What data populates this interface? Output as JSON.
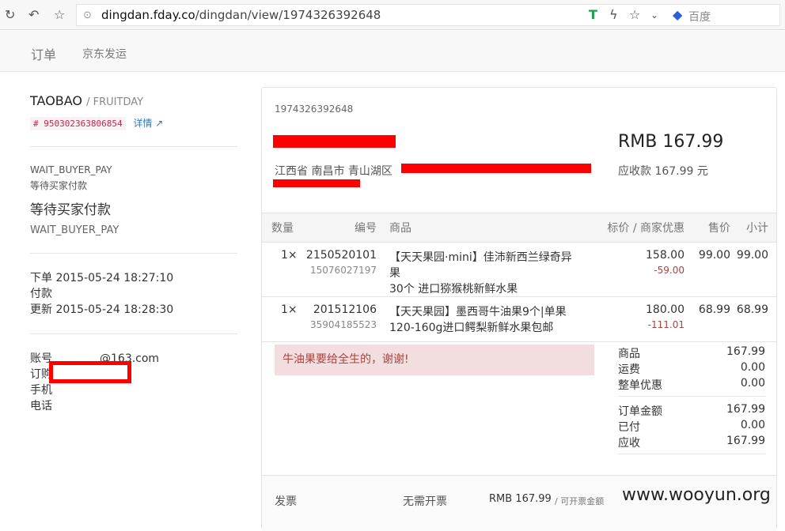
{
  "browser": {
    "url_domain": "dingdan.fday.co",
    "url_path": "/dingdan/view/1974326392648",
    "search_engine": "百度"
  },
  "nav": {
    "items": [
      "订单",
      "京东发运"
    ]
  },
  "order_meta": {
    "source": "TAOBAO",
    "sep_brand": "/ FRUITDAY",
    "trade_id": "# 950302363806854",
    "detail_link": "详情",
    "status_code": "WAIT_BUYER_PAY",
    "status_cn_small": "等待买家付款",
    "status_cn_large": "等待买家付款",
    "status_code2": "WAIT_BUYER_PAY",
    "time_rows": [
      {
        "label": "下单",
        "value": "2015-05-24 18:27:10"
      },
      {
        "label": "付款",
        "value": ""
      },
      {
        "label": "更新",
        "value": "2015-05-24 18:28:30"
      }
    ],
    "buyer_rows": [
      {
        "label": "账号",
        "value": "@163.com"
      },
      {
        "label": "订购",
        "value": ""
      },
      {
        "label": "手机",
        "value": ""
      },
      {
        "label": "电话",
        "value": ""
      }
    ]
  },
  "order": {
    "id": "1974326392648",
    "address": "江西省 南昌市 青山湖区",
    "amount": "RMB 167.99",
    "receivable": "应收款 167.99 元",
    "columns": [
      "数量",
      "编号",
      "商品",
      "标价 / 商家优惠",
      "售价",
      "小计"
    ],
    "items": [
      {
        "qty": "1×",
        "code": "2150520101",
        "sub_code": "15076027197",
        "name1": "【天天果园·mini】佳沛新西兰绿奇异果",
        "name2": "30个 进口猕猴桃新鲜水果",
        "list": "158.00",
        "discount": "-59.00",
        "price": "99.00",
        "subtotal": "99.00"
      },
      {
        "qty": "1×",
        "code": "201512106",
        "sub_code": "35904185523",
        "name1": "【天天果园】墨西哥牛油果9个|单果",
        "name2": "120-160g进口鳄梨新鲜水果包邮",
        "list": "180.00",
        "discount": "-111.01",
        "price": "68.99",
        "subtotal": "68.99"
      }
    ],
    "note": "牛油果要给全生的，谢谢!",
    "summary1": [
      {
        "label": "商品",
        "value": "167.99"
      },
      {
        "label": "运费",
        "value": "0.00"
      },
      {
        "label": "整单优惠",
        "value": "0.00"
      }
    ],
    "summary2": [
      {
        "label": "订单金额",
        "value": "167.99"
      },
      {
        "label": "已付",
        "value": "0.00"
      },
      {
        "label": "应收",
        "value": "167.99"
      }
    ],
    "invoice": {
      "label": "发票",
      "status": "无需开票",
      "amount": "RMB 167.99",
      "amount_note": "/ 可开票金额"
    }
  },
  "watermark": "www.wooyun.org",
  "colors": {
    "accent_red": "#ff0000",
    "tag_red": "#c7254e",
    "link_blue": "#337ab7"
  }
}
